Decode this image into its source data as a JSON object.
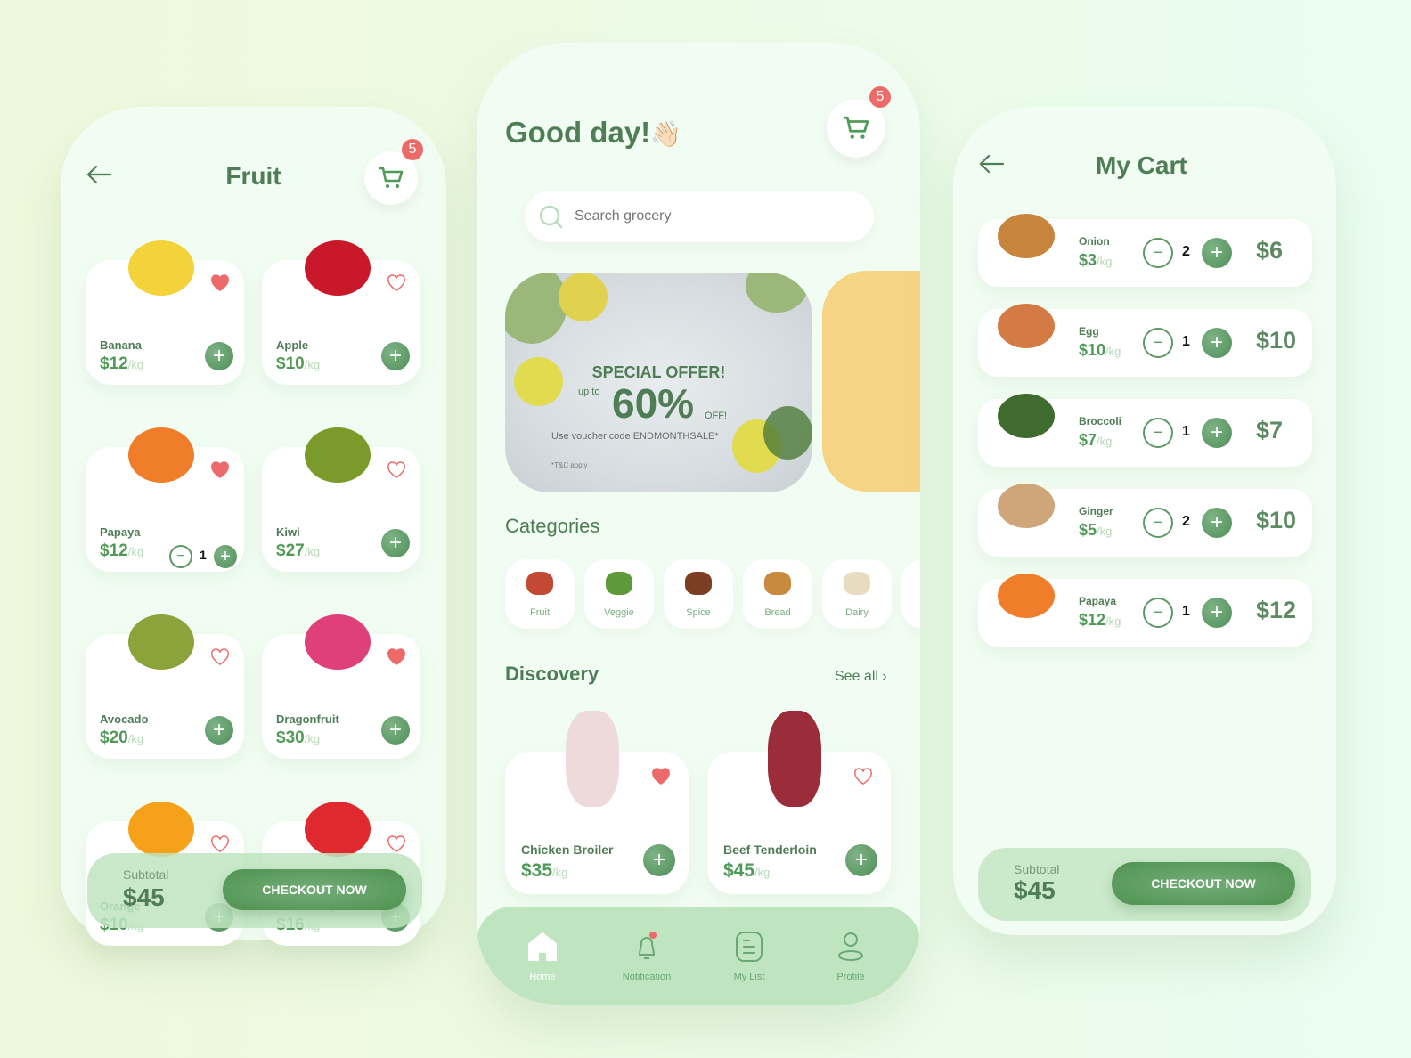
{
  "fruit_screen": {
    "title": "Fruit",
    "cart_count": "5",
    "items": [
      {
        "name": "Banana",
        "price": "$12",
        "unit": "/kg",
        "favorite": true
      },
      {
        "name": "Apple",
        "price": "$10",
        "unit": "/kg",
        "favorite": false
      },
      {
        "name": "Papaya",
        "price": "$12",
        "unit": "/kg",
        "favorite": true,
        "qty": "1"
      },
      {
        "name": "Kiwi",
        "price": "$27",
        "unit": "/kg",
        "favorite": false
      },
      {
        "name": "Avocado",
        "price": "$20",
        "unit": "/kg",
        "favorite": false
      },
      {
        "name": "Dragonfruit",
        "price": "$30",
        "unit": "/kg",
        "favorite": true
      },
      {
        "name": "Orange",
        "price": "$10",
        "unit": "/kg",
        "favorite": false
      },
      {
        "name": "Strawberry",
        "price": "$16",
        "unit": "/kg",
        "favorite": false
      }
    ],
    "subtotal_label": "Subtotal",
    "subtotal_value": "$45",
    "checkout_label": "CHECKOUT NOW"
  },
  "home_screen": {
    "greeting": "Good day!",
    "greeting_emoji": "👋🏻",
    "cart_count": "5",
    "search_placeholder": "Search grocery",
    "banner": {
      "headline": "SPECIAL OFFER!",
      "up_to": "up to",
      "percent": "60%",
      "off": "OFF!",
      "voucher": "Use voucher code ENDMONTHSALE*",
      "terms": "*T&C apply"
    },
    "categories_title": "Categories",
    "categories": [
      "Fruit",
      "Veggie",
      "Spice",
      "Bread",
      "Dairy"
    ],
    "discovery_title": "Discovery",
    "see_all": "See all ›",
    "discovery": [
      {
        "name": "Chicken Broiler",
        "price": "$35",
        "unit": "/kg",
        "favorite": true
      },
      {
        "name": "Beef Tenderloin",
        "price": "$45",
        "unit": "/kg",
        "favorite": false
      }
    ],
    "nav": [
      "Home",
      "Notification",
      "My List",
      "Profile"
    ],
    "active_nav": "Home"
  },
  "cart_screen": {
    "title": "My Cart",
    "items": [
      {
        "name": "Onion",
        "price": "$3",
        "unit": "/kg",
        "qty": "2",
        "total": "$6"
      },
      {
        "name": "Egg",
        "price": "$10",
        "unit": "/kg",
        "qty": "1",
        "total": "$10"
      },
      {
        "name": "Broccoli",
        "price": "$7",
        "unit": "/kg",
        "qty": "1",
        "total": "$7"
      },
      {
        "name": "Ginger",
        "price": "$5",
        "unit": "/kg",
        "qty": "2",
        "total": "$10"
      },
      {
        "name": "Papaya",
        "price": "$12",
        "unit": "/kg",
        "qty": "1",
        "total": "$12"
      }
    ],
    "subtotal_label": "Subtotal",
    "subtotal_value": "$45",
    "checkout_label": "CHECKOUT NOW"
  },
  "colors": {
    "brand_green": "#4f7d56",
    "accent_green": "#5c9a63",
    "heart_red": "#ec6a6a",
    "banner_yellow": "#f5d584"
  }
}
